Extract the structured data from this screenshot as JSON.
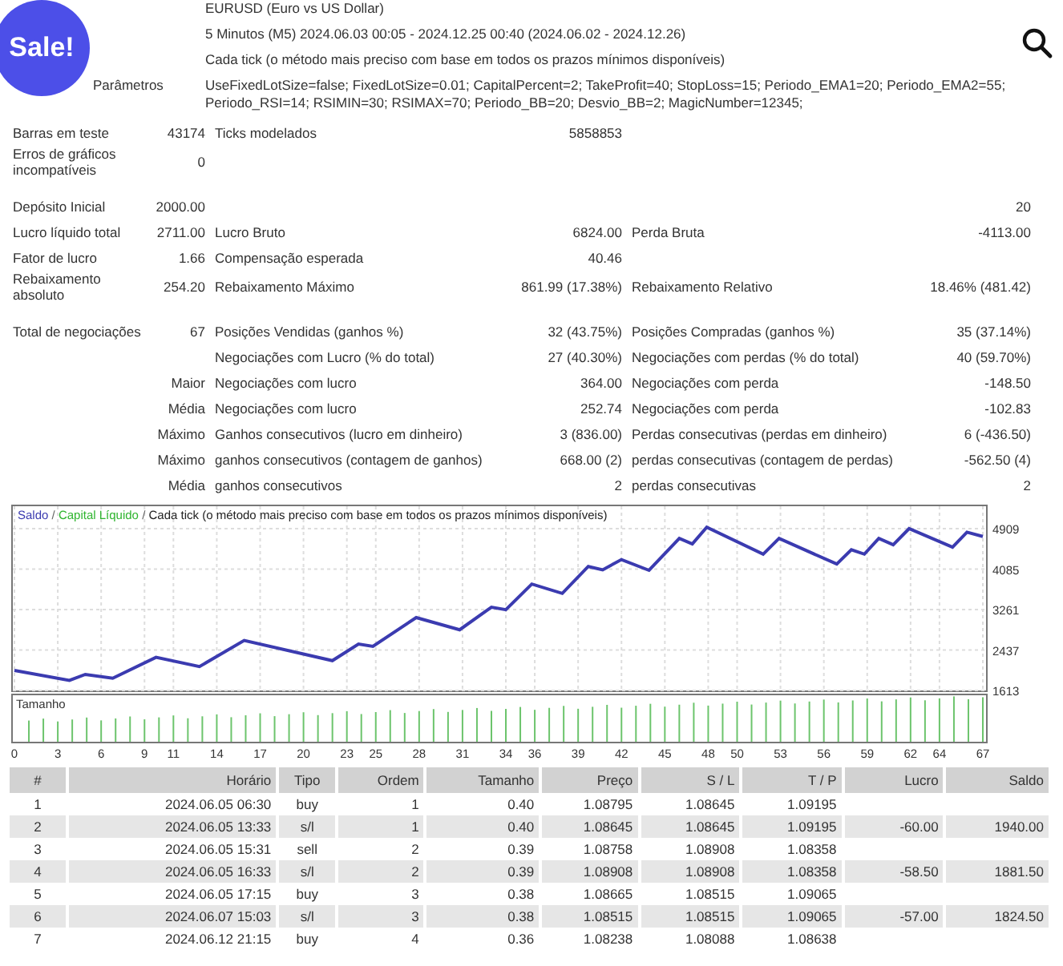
{
  "badge": {
    "label": "Sale!"
  },
  "header": [
    {
      "value": "EURUSD (Euro vs US Dollar)"
    },
    {
      "value": "5 Minutos (M5) 2024.06.03 00:05 - 2024.12.25 00:40 (2024.06.02 - 2024.12.26)"
    },
    {
      "value": "Cada tick (o método mais preciso com base em todos os prazos mínimos disponíveis)"
    },
    {
      "label": "Parâmetros",
      "value": "UseFixedLotSize=false; FixedLotSize=0.01; CapitalPercent=2; TakeProfit=40; StopLoss=15; Periodo_EMA1=20; Periodo_EMA2=55; Periodo_RSI=14; RSIMIN=30; RSIMAX=70; Periodo_BB=20; Desvio_BB=2; MagicNumber=12345;"
    }
  ],
  "stats": [
    [
      {
        "label": "Barras em teste",
        "value": "43174",
        "label2": "Ticks modelados",
        "value2": "5858853"
      },
      {
        "label": "Erros de gráficos incompatíveis",
        "value": "0"
      }
    ],
    [
      {
        "label": "Depósito Inicial",
        "value": "2000.00",
        "value3": "20"
      },
      {
        "label": "Lucro líquido total",
        "value": "2711.00",
        "label2": "Lucro Bruto",
        "value2": "6824.00",
        "label3": "Perda Bruta",
        "value3": "-4113.00"
      },
      {
        "label": "Fator de lucro",
        "value": "1.66",
        "label2": "Compensação esperada",
        "value2": "40.46"
      },
      {
        "label": "Rebaixamento absoluto",
        "value": "254.20",
        "label2": "Rebaixamento Máximo",
        "value2": "861.99 (17.38%)",
        "label3": "Rebaixamento Relativo",
        "value3": "18.46% (481.42)"
      }
    ],
    [
      {
        "label": "Total de negociações",
        "value": "67",
        "label2": "Posições Vendidas (ganhos %)",
        "value2": "32 (43.75%)",
        "label3": "Posições Compradas (ganhos %)",
        "value3": "35 (37.14%)"
      },
      {
        "label2": "Negociações com Lucro (% do total)",
        "value2": "27 (40.30%)",
        "label3": "Negociações com perdas (% do total)",
        "value3": "40 (59.70%)"
      },
      {
        "value": "Maior",
        "label2": "Negociações com lucro",
        "value2": "364.00",
        "label3": "Negociações com perda",
        "value3": "-148.50"
      },
      {
        "value": "Média",
        "label2": "Negociações com lucro",
        "value2": "252.74",
        "label3": "Negociações com perda",
        "value3": "-102.83"
      },
      {
        "value": "Máximo",
        "label2": "Ganhos consecutivos (lucro em dinheiro)",
        "value2": "3 (836.00)",
        "label3": "Perdas consecutivas (perdas em dinheiro)",
        "value3": "6 (-436.50)"
      },
      {
        "value": "Máximo",
        "label2": "ganhos consecutivos (contagem de ganhos)",
        "value2": "668.00 (2)",
        "label3": "perdas consecutivas (contagem de perdas)",
        "value3": "-562.50 (4)"
      },
      {
        "value": "Média",
        "label2": "ganhos consecutivos",
        "value2": "2",
        "label3": "perdas consecutivas",
        "value3": "2"
      }
    ]
  ],
  "chart": {
    "legend": [
      {
        "text": "/",
        "color": "#666666"
      },
      {
        "text": "Capital Líquido",
        "color": "#2fb52f"
      },
      {
        "text": "/",
        "color": "#666666"
      },
      {
        "text": "Cada tick (o método mais preciso com base em todos os prazos mínimos disponíveis)",
        "color": "#222222"
      }
    ],
    "volume_label": "Tamanho",
    "chart_data": {
      "type": "line",
      "grid": true,
      "x": [
        0,
        3.8,
        4.9,
        6.8,
        9.8,
        12.8,
        15.9,
        22,
        23.8,
        24.8,
        27.8,
        30.8,
        33,
        34,
        35.8,
        37.9,
        39.7,
        40.7,
        42,
        43.9,
        46,
        46.9,
        47.9,
        51.8,
        52.9,
        56.9,
        57.9,
        58.8,
        59.8,
        60.8,
        61.9,
        64.9,
        65.9,
        67
      ],
      "series": [
        {
          "name": "Saldo",
          "color": "#3b3bb0",
          "values": [
            2020,
            1820,
            1940,
            1860,
            2290,
            2100,
            2630,
            2220,
            2560,
            2510,
            3100,
            2850,
            3310,
            3260,
            3780,
            3590,
            4140,
            4070,
            4280,
            4060,
            4710,
            4600,
            4940,
            4390,
            4710,
            4190,
            4480,
            4390,
            4710,
            4580,
            4910,
            4530,
            4840,
            4750
          ]
        }
      ],
      "xlim": [
        0,
        67
      ],
      "ylim": [
        1613,
        5400
      ],
      "yticks": [
        1613,
        2437,
        3261,
        4085,
        4909
      ],
      "xticks": [
        0,
        3,
        6,
        9,
        11,
        14,
        17,
        20,
        23,
        25,
        28,
        31,
        34,
        36,
        39,
        42,
        45,
        48,
        50,
        53,
        56,
        59,
        62,
        64,
        67
      ]
    }
  },
  "trades": {
    "columns": [
      "#",
      "Horário",
      "Tipo",
      "Ordem",
      "Tamanho",
      "Preço",
      "S / L",
      "T / P",
      "Lucro",
      "Saldo"
    ],
    "rows": [
      {
        "n": "1",
        "time": "2024.06.05 06:30",
        "type": "buy",
        "order": "1",
        "size": "0.40",
        "price": "1.08795",
        "sl": "1.08645",
        "tp": "1.09195"
      },
      {
        "n": "2",
        "time": "2024.06.05 13:33",
        "type": "s/l",
        "order": "1",
        "size": "0.40",
        "price": "1.08645",
        "sl": "1.08645",
        "tp": "1.09195",
        "profit": "-60.00",
        "balance": "1940.00"
      },
      {
        "n": "3",
        "time": "2024.06.05 15:31",
        "type": "sell",
        "order": "2",
        "size": "0.39",
        "price": "1.08758",
        "sl": "1.08908",
        "tp": "1.08358"
      },
      {
        "n": "4",
        "time": "2024.06.05 16:33",
        "type": "s/l",
        "order": "2",
        "size": "0.39",
        "price": "1.08908",
        "sl": "1.08908",
        "tp": "1.08358",
        "profit": "-58.50",
        "balance": "1881.50"
      },
      {
        "n": "5",
        "time": "2024.06.05 17:15",
        "type": "buy",
        "order": "3",
        "size": "0.38",
        "price": "1.08665",
        "sl": "1.08515",
        "tp": "1.09065"
      },
      {
        "n": "6",
        "time": "2024.06.07 15:03",
        "type": "s/l",
        "order": "3",
        "size": "0.38",
        "price": "1.08515",
        "sl": "1.08515",
        "tp": "1.09065",
        "profit": "-57.00",
        "balance": "1824.50"
      },
      {
        "n": "7",
        "time": "2024.06.12 21:15",
        "type": "buy",
        "order": "4",
        "size": "0.36",
        "price": "1.08238",
        "sl": "1.08088",
        "tp": "1.08638"
      }
    ]
  }
}
